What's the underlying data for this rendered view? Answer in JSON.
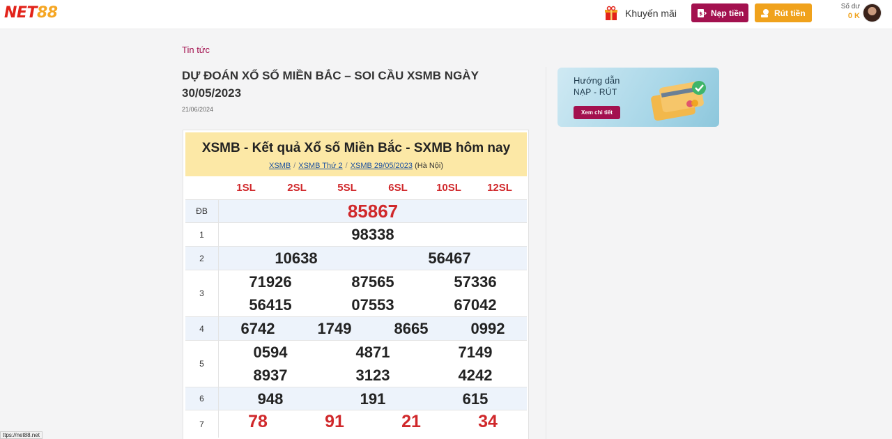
{
  "header": {
    "logo_part1": "NET",
    "logo_part2": "88",
    "promo_label": "Khuyến mãi",
    "deposit_label": "Nạp tiền",
    "withdraw_label": "Rút tiền",
    "balance_label": "Số dư",
    "balance_value": "0 K"
  },
  "article": {
    "breadcrumb": "Tin tức",
    "title": "DỰ ĐOÁN XỔ SỐ MIỀN BẮC – SOI CẦU XSMB NGÀY 30/05/2023",
    "date": "21/06/2024"
  },
  "banner": {
    "line1": "Hướng dẫn",
    "line2": "NẠP - RÚT",
    "cta": "Xem chi tiết"
  },
  "results": {
    "title": "XSMB - Kết quả Xổ số Miền Bắc - SXMB hôm nay",
    "crumbs": [
      "XSMB",
      "XSMB Thứ 2",
      "XSMB 29/05/2023"
    ],
    "crumb_suffix": "(Hà Nội)",
    "sl": [
      "1SL",
      "2SL",
      "5SL",
      "6SL",
      "10SL",
      "12SL"
    ],
    "prizes": [
      {
        "label": "ĐB",
        "numbers": [
          "85867"
        ]
      },
      {
        "label": "1",
        "numbers": [
          "98338"
        ]
      },
      {
        "label": "2",
        "numbers": [
          "10638",
          "56467"
        ]
      },
      {
        "label": "3",
        "numbers": [
          "71926",
          "87565",
          "57336",
          "56415",
          "07553",
          "67042"
        ]
      },
      {
        "label": "4",
        "numbers": [
          "6742",
          "1749",
          "8665",
          "0992"
        ]
      },
      {
        "label": "5",
        "numbers": [
          "0594",
          "4871",
          "7149",
          "8937",
          "3123",
          "4242"
        ]
      },
      {
        "label": "6",
        "numbers": [
          "948",
          "191",
          "615"
        ]
      },
      {
        "label": "7",
        "numbers": [
          "78",
          "91",
          "21",
          "34"
        ]
      }
    ]
  },
  "status_bar": "ttps://net88.net",
  "colors": {
    "brand": "#a3114f",
    "accent": "#f0a21c",
    "prize_red": "#d0282b"
  }
}
